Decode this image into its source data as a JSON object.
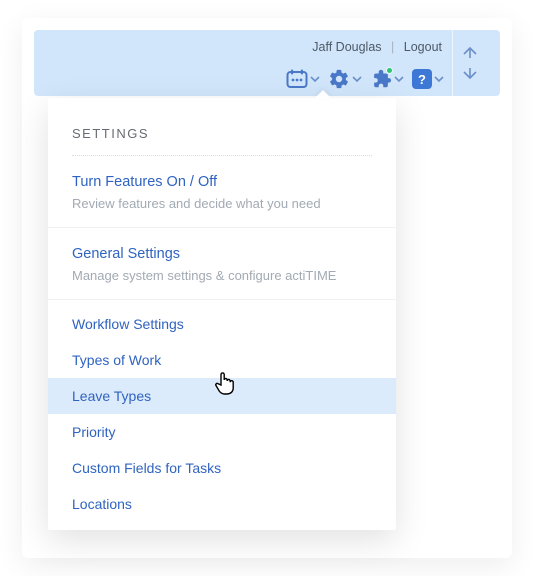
{
  "header": {
    "user_name": "Jaff Douglas",
    "logout_label": "Logout",
    "help_glyph": "?"
  },
  "settings_menu": {
    "title": "SETTINGS",
    "blocks": [
      {
        "head": "Turn Features On / Off",
        "sub": "Review features and decide what you need"
      },
      {
        "head": "General Settings",
        "sub": "Manage system settings & configure actiTIME"
      }
    ],
    "items": [
      "Workflow Settings",
      "Types of Work",
      "Leave Types",
      "Priority",
      "Custom Fields for Tasks",
      "Locations"
    ],
    "hovered_index": 2
  }
}
